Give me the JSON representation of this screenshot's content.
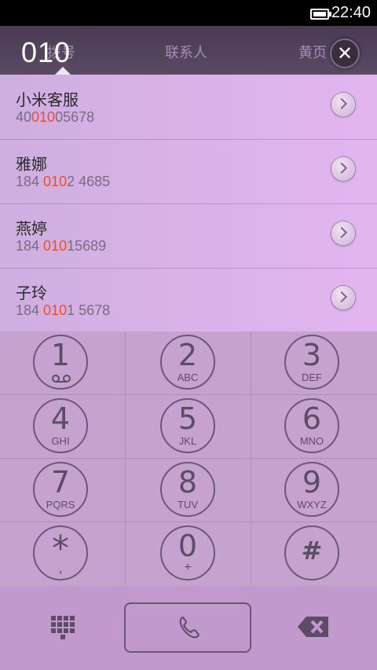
{
  "status_bar": {
    "time": "22:40"
  },
  "header": {
    "tabs": [
      "拨号",
      "联系人",
      "黄页"
    ],
    "dialed_number": "010"
  },
  "results": [
    {
      "name": "小米客服",
      "number_prefix": "40",
      "number_match": "010",
      "number_suffix": "05678"
    },
    {
      "name": "雅娜",
      "number_prefix": "184 ",
      "number_match": "010",
      "number_suffix": "2 4685"
    },
    {
      "name": "燕婷",
      "number_prefix": "184 ",
      "number_match": "010",
      "number_suffix": "15689"
    },
    {
      "name": "子玲",
      "number_prefix": "184 ",
      "number_match": "010",
      "number_suffix": "1 5678"
    }
  ],
  "keypad": [
    {
      "digit": "1",
      "letters": ""
    },
    {
      "digit": "2",
      "letters": "ABC"
    },
    {
      "digit": "3",
      "letters": "DEF"
    },
    {
      "digit": "4",
      "letters": "GHI"
    },
    {
      "digit": "5",
      "letters": "JKL"
    },
    {
      "digit": "6",
      "letters": "MNO"
    },
    {
      "digit": "7",
      "letters": "PQRS"
    },
    {
      "digit": "8",
      "letters": "TUV"
    },
    {
      "digit": "9",
      "letters": "WXYZ"
    },
    {
      "digit": "*",
      "letters": ","
    },
    {
      "digit": "0",
      "letters": "+"
    },
    {
      "digit": "#",
      "letters": ""
    }
  ],
  "colors": {
    "match_highlight": "#e8502f",
    "header_bg": "#4a3a52",
    "keypad_ink": "#5d4c66"
  },
  "icons": {
    "clear": "close-icon",
    "detail": "chevron-right-icon",
    "voicemail": "voicemail-icon",
    "keypad_toggle": "keypad-grid-icon",
    "call": "phone-icon",
    "backspace": "backspace-icon"
  }
}
